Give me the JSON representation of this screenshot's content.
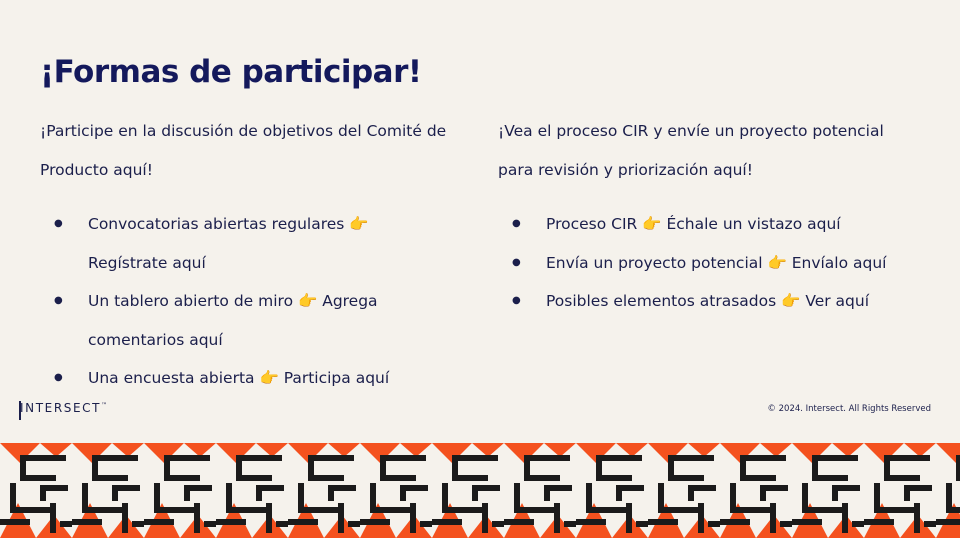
{
  "slide": {
    "title": "¡Formas de participar!",
    "left": {
      "intro_line1": "¡Participe en la discusión de objetivos del Comité de",
      "intro_line2": "Producto aquí!",
      "items": [
        {
          "line1": "Convocatorias abiertas regulares 👉",
          "line2": "Regístrate aquí"
        },
        {
          "line1": "Un tablero abierto de miro 👉 Agrega",
          "line2": "comentarios aquí"
        },
        {
          "line1": "Una encuesta abierta 👉 Participa aquí"
        }
      ]
    },
    "right": {
      "intro_line1": "¡Vea el proceso CIR y envíe un proyecto potencial",
      "intro_line2": "para revisión y priorización aquí!",
      "items": [
        {
          "line1": "Proceso CIR 👉 Échale un vistazo aquí"
        },
        {
          "line1": "Envía un proyecto potencial 👉 Envíalo aquí"
        },
        {
          "line1": "Posibles elementos atrasados 👉 Ver aquí"
        }
      ]
    },
    "bullet": "●"
  },
  "footer": {
    "logo_text": "INTERSECT",
    "logo_tm": "™",
    "copyright": "© 2024. Intersect. All Rights Reserved"
  },
  "colors": {
    "title": "#14195c",
    "text": "#1b1f4b",
    "background": "#f5f2ec",
    "pattern_orange": "#f4511e",
    "pattern_black": "#1b1b1b",
    "pattern_cream": "#f5f2ec"
  }
}
